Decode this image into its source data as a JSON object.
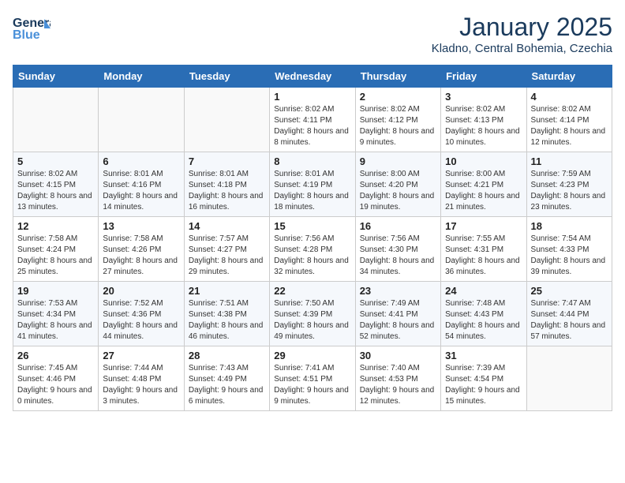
{
  "header": {
    "logo_line1": "General",
    "logo_line2": "Blue",
    "month": "January 2025",
    "location": "Kladno, Central Bohemia, Czechia"
  },
  "days_of_week": [
    "Sunday",
    "Monday",
    "Tuesday",
    "Wednesday",
    "Thursday",
    "Friday",
    "Saturday"
  ],
  "weeks": [
    [
      {
        "num": "",
        "info": ""
      },
      {
        "num": "",
        "info": ""
      },
      {
        "num": "",
        "info": ""
      },
      {
        "num": "1",
        "info": "Sunrise: 8:02 AM\nSunset: 4:11 PM\nDaylight: 8 hours and 8 minutes."
      },
      {
        "num": "2",
        "info": "Sunrise: 8:02 AM\nSunset: 4:12 PM\nDaylight: 8 hours and 9 minutes."
      },
      {
        "num": "3",
        "info": "Sunrise: 8:02 AM\nSunset: 4:13 PM\nDaylight: 8 hours and 10 minutes."
      },
      {
        "num": "4",
        "info": "Sunrise: 8:02 AM\nSunset: 4:14 PM\nDaylight: 8 hours and 12 minutes."
      }
    ],
    [
      {
        "num": "5",
        "info": "Sunrise: 8:02 AM\nSunset: 4:15 PM\nDaylight: 8 hours and 13 minutes."
      },
      {
        "num": "6",
        "info": "Sunrise: 8:01 AM\nSunset: 4:16 PM\nDaylight: 8 hours and 14 minutes."
      },
      {
        "num": "7",
        "info": "Sunrise: 8:01 AM\nSunset: 4:18 PM\nDaylight: 8 hours and 16 minutes."
      },
      {
        "num": "8",
        "info": "Sunrise: 8:01 AM\nSunset: 4:19 PM\nDaylight: 8 hours and 18 minutes."
      },
      {
        "num": "9",
        "info": "Sunrise: 8:00 AM\nSunset: 4:20 PM\nDaylight: 8 hours and 19 minutes."
      },
      {
        "num": "10",
        "info": "Sunrise: 8:00 AM\nSunset: 4:21 PM\nDaylight: 8 hours and 21 minutes."
      },
      {
        "num": "11",
        "info": "Sunrise: 7:59 AM\nSunset: 4:23 PM\nDaylight: 8 hours and 23 minutes."
      }
    ],
    [
      {
        "num": "12",
        "info": "Sunrise: 7:58 AM\nSunset: 4:24 PM\nDaylight: 8 hours and 25 minutes."
      },
      {
        "num": "13",
        "info": "Sunrise: 7:58 AM\nSunset: 4:26 PM\nDaylight: 8 hours and 27 minutes."
      },
      {
        "num": "14",
        "info": "Sunrise: 7:57 AM\nSunset: 4:27 PM\nDaylight: 8 hours and 29 minutes."
      },
      {
        "num": "15",
        "info": "Sunrise: 7:56 AM\nSunset: 4:28 PM\nDaylight: 8 hours and 32 minutes."
      },
      {
        "num": "16",
        "info": "Sunrise: 7:56 AM\nSunset: 4:30 PM\nDaylight: 8 hours and 34 minutes."
      },
      {
        "num": "17",
        "info": "Sunrise: 7:55 AM\nSunset: 4:31 PM\nDaylight: 8 hours and 36 minutes."
      },
      {
        "num": "18",
        "info": "Sunrise: 7:54 AM\nSunset: 4:33 PM\nDaylight: 8 hours and 39 minutes."
      }
    ],
    [
      {
        "num": "19",
        "info": "Sunrise: 7:53 AM\nSunset: 4:34 PM\nDaylight: 8 hours and 41 minutes."
      },
      {
        "num": "20",
        "info": "Sunrise: 7:52 AM\nSunset: 4:36 PM\nDaylight: 8 hours and 44 minutes."
      },
      {
        "num": "21",
        "info": "Sunrise: 7:51 AM\nSunset: 4:38 PM\nDaylight: 8 hours and 46 minutes."
      },
      {
        "num": "22",
        "info": "Sunrise: 7:50 AM\nSunset: 4:39 PM\nDaylight: 8 hours and 49 minutes."
      },
      {
        "num": "23",
        "info": "Sunrise: 7:49 AM\nSunset: 4:41 PM\nDaylight: 8 hours and 52 minutes."
      },
      {
        "num": "24",
        "info": "Sunrise: 7:48 AM\nSunset: 4:43 PM\nDaylight: 8 hours and 54 minutes."
      },
      {
        "num": "25",
        "info": "Sunrise: 7:47 AM\nSunset: 4:44 PM\nDaylight: 8 hours and 57 minutes."
      }
    ],
    [
      {
        "num": "26",
        "info": "Sunrise: 7:45 AM\nSunset: 4:46 PM\nDaylight: 9 hours and 0 minutes."
      },
      {
        "num": "27",
        "info": "Sunrise: 7:44 AM\nSunset: 4:48 PM\nDaylight: 9 hours and 3 minutes."
      },
      {
        "num": "28",
        "info": "Sunrise: 7:43 AM\nSunset: 4:49 PM\nDaylight: 9 hours and 6 minutes."
      },
      {
        "num": "29",
        "info": "Sunrise: 7:41 AM\nSunset: 4:51 PM\nDaylight: 9 hours and 9 minutes."
      },
      {
        "num": "30",
        "info": "Sunrise: 7:40 AM\nSunset: 4:53 PM\nDaylight: 9 hours and 12 minutes."
      },
      {
        "num": "31",
        "info": "Sunrise: 7:39 AM\nSunset: 4:54 PM\nDaylight: 9 hours and 15 minutes."
      },
      {
        "num": "",
        "info": ""
      }
    ]
  ]
}
